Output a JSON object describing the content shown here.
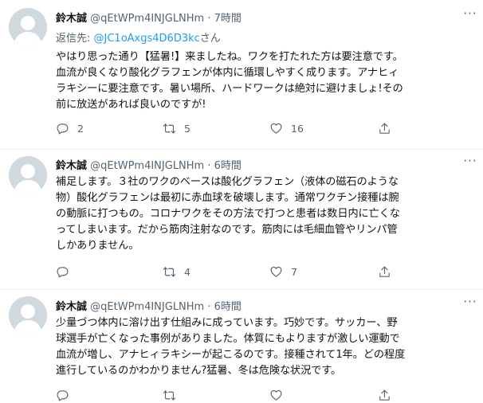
{
  "tweets": [
    {
      "name": "鈴木誠",
      "handle": "@qEtWPm4INJGLNHm",
      "separator": "·",
      "time": "7時間",
      "replying_prefix": "返信先: ",
      "replying_mention": "@JC1oAxgs4D6D3kc",
      "replying_suffix": "さん",
      "body": "やはり思った通り【猛暑!】来ましたね。ワクを打たれた方は要注意です。\n血流が良くなり酸化グラフェンが体内に循環しやすく成ります。アナヒィ\nラキシーに要注意です。暑い場所、ハードワークは絶対に避けましょ!その\n前に放送があれば良いのですが!",
      "reply_count": "2",
      "retweet_count": "5",
      "like_count": "16"
    },
    {
      "name": "鈴木誠",
      "handle": "@qEtWPm4INJGLNHm",
      "separator": "·",
      "time": "6時間",
      "body": "補足します。３社のワクのベースは酸化グラフェン（液体の磁石のような\n物）酸化グラフェンは最初に赤血球を破壊します。通常ワクチン接種は腕\nの動脈に打つもの。コロナワクをその方法で打つと患者は数日内に亡くな\nってしまいます。だから筋肉注射なのです。筋肉には毛細血管やリンパ管\nしかありません。",
      "reply_count": "",
      "retweet_count": "4",
      "like_count": "7"
    },
    {
      "name": "鈴木誠",
      "handle": "@qEtWPm4INJGLNHm",
      "separator": "·",
      "time": "6時間",
      "body": "少量づつ体内に溶け出す仕組みに成っています。巧妙です。サッカー、野\n球選手が亡くなった事例がありました。体質にもよりますが激しい運動で\n血流が増し、アナヒィラキシーが起こるのです。接種されて1年。どの程度\n進行しているのかわかりません?猛暑、冬は危険な状況です。",
      "reply_count": "",
      "retweet_count": "",
      "like_count": ""
    }
  ],
  "icons": {
    "reply": "reply-icon",
    "retweet": "retweet-icon",
    "like": "heart-icon",
    "share": "share-icon",
    "more": "more-icon",
    "avatar": "default-avatar"
  },
  "colors": {
    "text": "#0f1419",
    "secondary": "#536471",
    "link": "#1d9bf0",
    "avatar_bg": "#cfd9de",
    "divider": "#eff3f4"
  }
}
